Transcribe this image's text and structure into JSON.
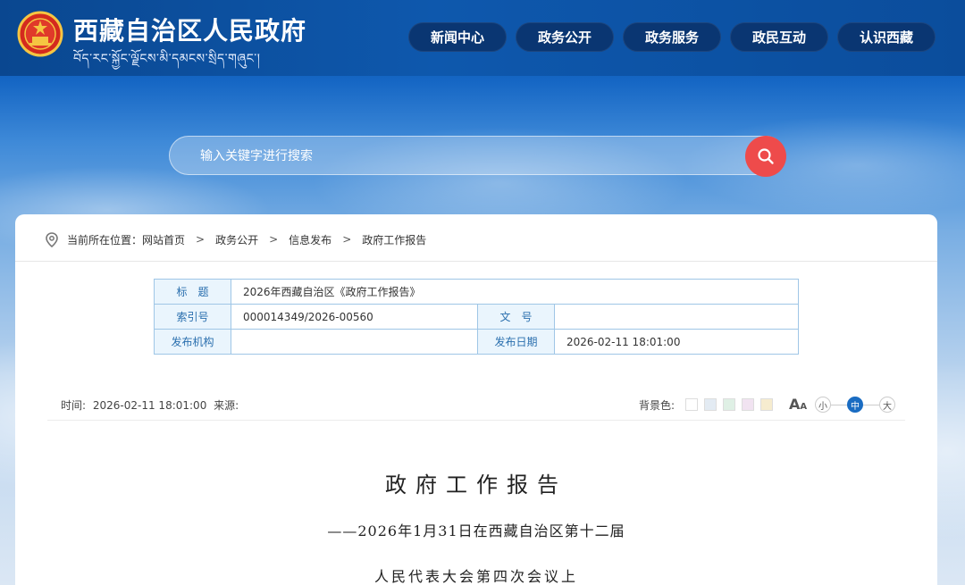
{
  "header": {
    "site_title": "西藏自治区人民政府",
    "site_subtitle": "བོད་རང་སྐྱོང་ལྗོངས་མི་དམངས་སྲིད་གཞུང་།",
    "nav": [
      "新闻中心",
      "政务公开",
      "政务服务",
      "政民互动",
      "认识西藏"
    ]
  },
  "search": {
    "placeholder": "输入关键字进行搜索"
  },
  "breadcrumb": {
    "prefix": "当前所在位置：",
    "items": [
      "网站首页",
      "政务公开",
      "信息发布",
      "政府工作报告"
    ],
    "separator": ">"
  },
  "meta_table": {
    "title_label": "标　题",
    "title_value": "2026年西藏自治区《政府工作报告》",
    "index_label": "索引号",
    "index_value": "000014349/2026-00560",
    "docno_label": "文　号",
    "docno_value": "",
    "org_label": "发布机构",
    "org_value": "",
    "date_label": "发布日期",
    "date_value": "2026-02-11 18:01:00"
  },
  "info_bar": {
    "time_label": "时间:",
    "time_value": "2026-02-11 18:01:00",
    "source_label": "来源:",
    "bg_label": "背景色:",
    "bg_colors": [
      "#ffffff",
      "#e3ebf3",
      "#dff0e5",
      "#f1e3f1",
      "#f6eccf"
    ],
    "font_size_icon": "A",
    "font_sizes": [
      "小",
      "中",
      "大"
    ],
    "active_font_size": "中"
  },
  "article": {
    "title": "政府工作报告",
    "subtitle_line1": "——2026年1月31日在西藏自治区第十二届",
    "subtitle_line2": "人民代表大会第四次会议上"
  },
  "colors": {
    "header_bg": "#0b4d9c",
    "nav_bg": "#0a3672",
    "search_button": "#ee4b4b",
    "table_border": "#9fc6e6",
    "table_key_bg": "#eaf5fd",
    "active_font_btn": "#1a6cc2"
  }
}
